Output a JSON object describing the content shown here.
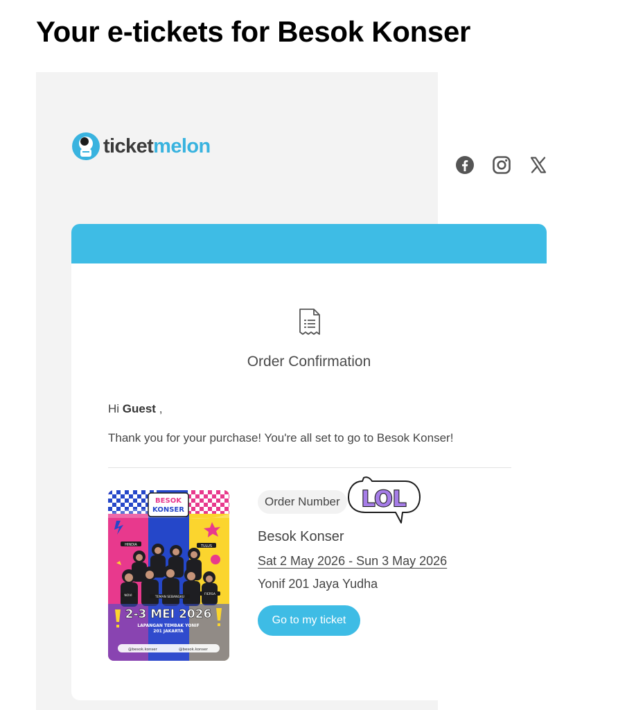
{
  "page_title": "Your e-tickets for Besok Konser",
  "brand": {
    "name_part1": "ticket",
    "name_part2": "melon",
    "accent_color": "#3ebce5"
  },
  "social_icons": [
    "facebook-icon",
    "instagram-icon",
    "x-icon"
  ],
  "email": {
    "heading": "Order Confirmation",
    "greeting_prefix": "Hi ",
    "greeting_name": "Guest",
    "greeting_suffix": " ,",
    "thanks": "Thank you for your purchase! You're all set to go to Besok Konser!"
  },
  "poster": {
    "logo_line1": "BESOK",
    "logo_line2": "KONSER",
    "dates": "2-3 MEI 2026",
    "venue_line1": "LAPANGAN TEMBAK YONIF",
    "venue_line2": "201 JAKARTA",
    "social_1": "@besok.konser",
    "social_2": "@besok.konser",
    "artists": [
      "HINDIA",
      "TULUS",
      "FIERSA",
      "NOVI",
      "TEMAN SEBANGKU"
    ]
  },
  "order": {
    "number_label": "Order Number",
    "sticker_text": "LOL",
    "event_name": "Besok Konser",
    "dates": "Sat 2 May 2026 - Sun 3 May 2026",
    "venue": "Yonif 201 Jaya Yudha",
    "button_label": "Go to my ticket"
  }
}
